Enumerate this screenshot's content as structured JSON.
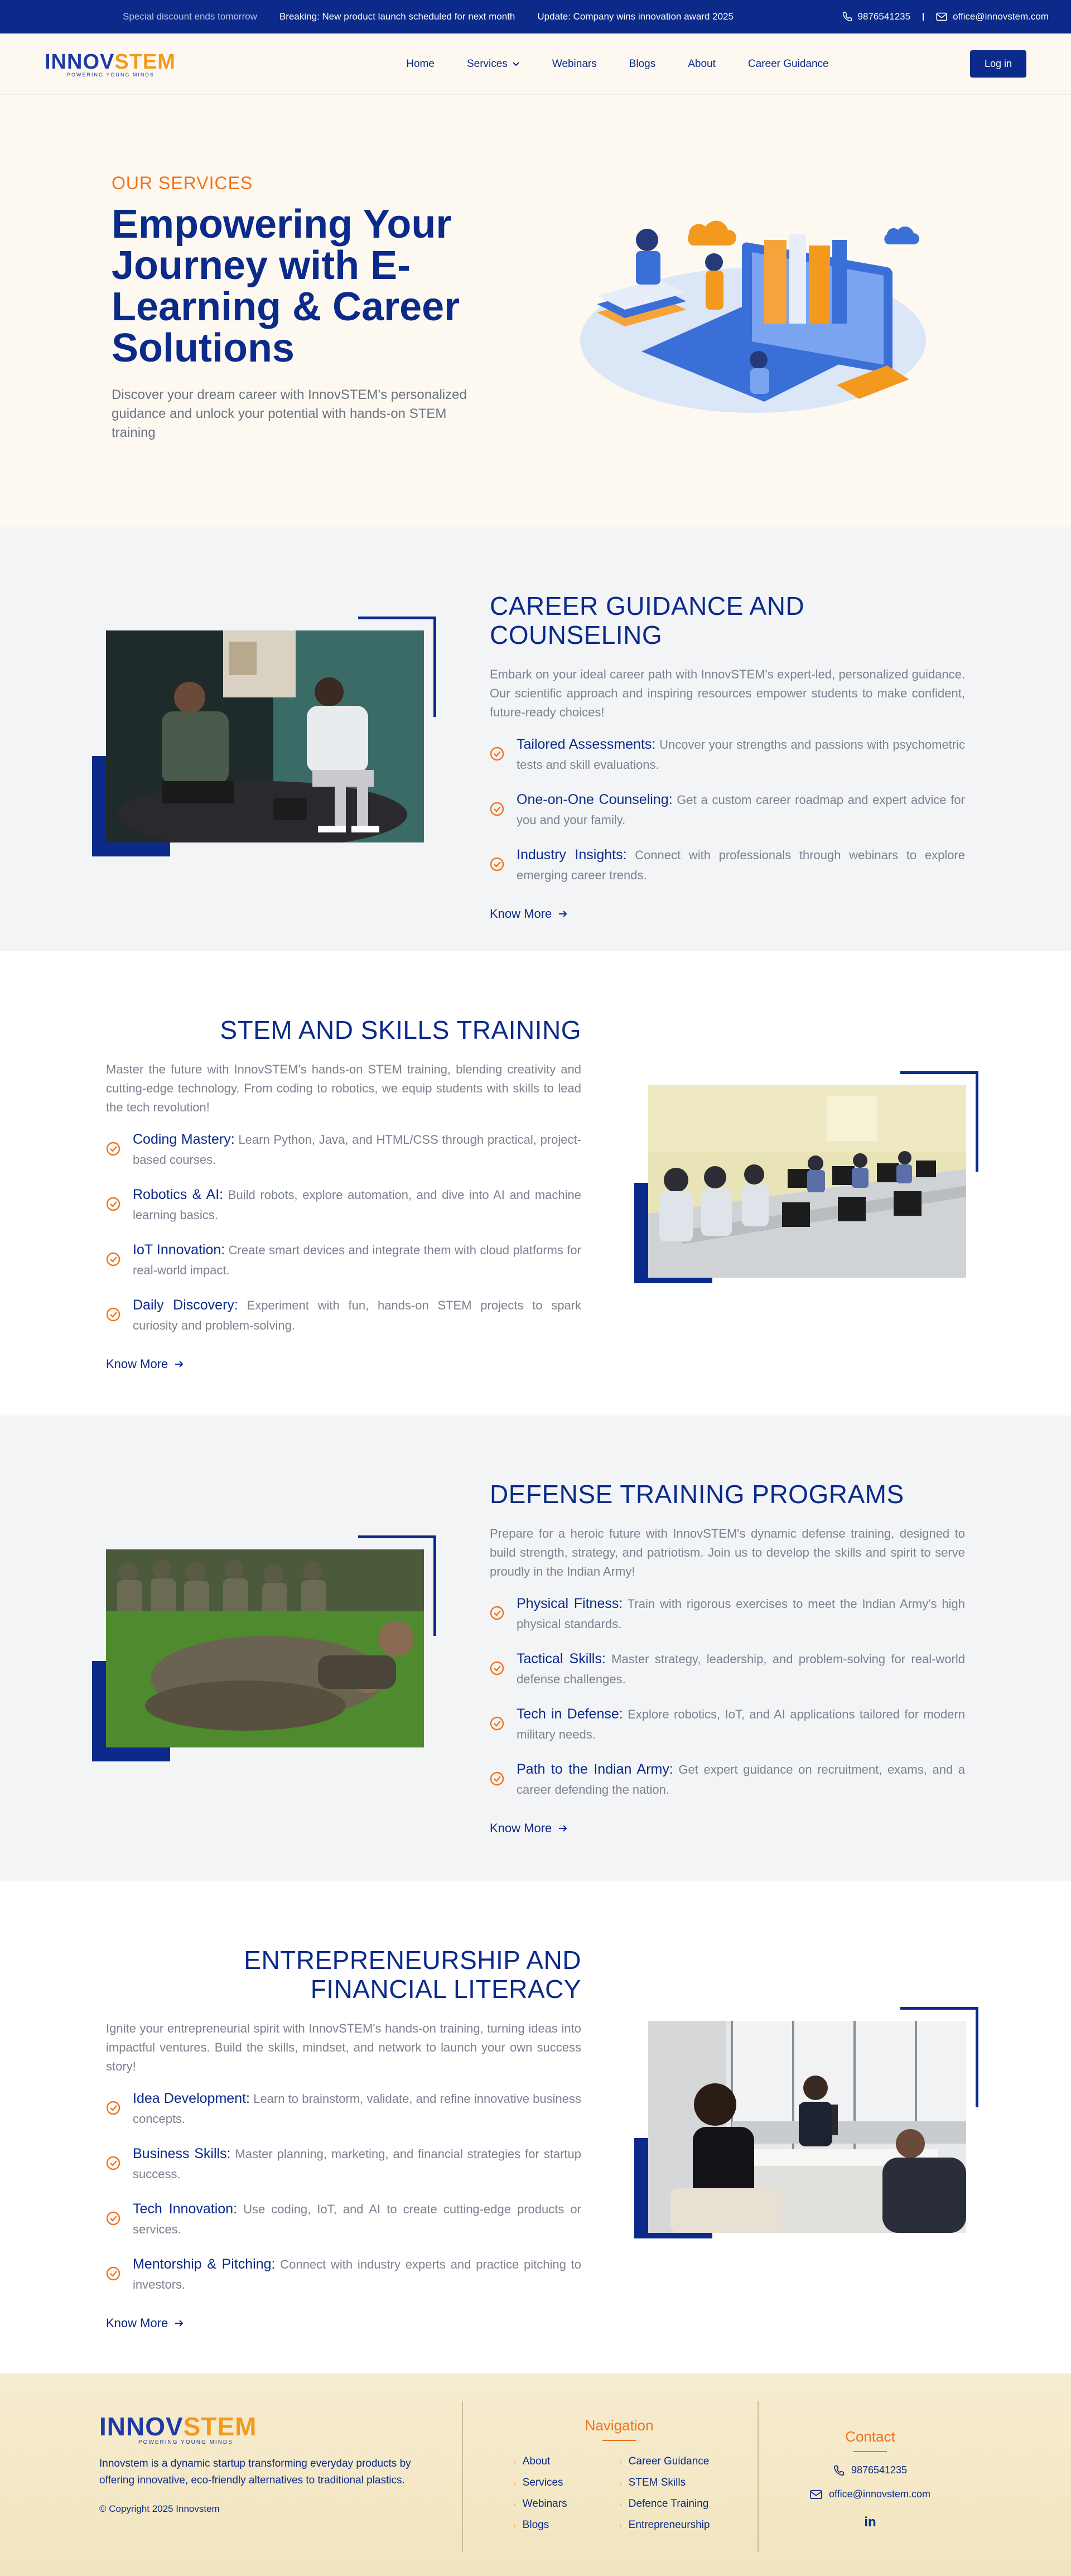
{
  "topbar": {
    "ticker": [
      "Special discount ends tomorrow",
      "Breaking: New product launch scheduled for next month",
      "Update: Company wins innovation award 2025"
    ],
    "phone": "9876541235",
    "email": "office@innovstem.com"
  },
  "nav": {
    "logo_part1": "INNOV",
    "logo_part2": "STEM",
    "logo_tagline": "POWERING YOUNG MINDS",
    "items": [
      "Home",
      "Services",
      "Webinars",
      "Blogs",
      "About",
      "Career Guidance"
    ],
    "login": "Log in"
  },
  "hero": {
    "eyebrow": "OUR SERVICES",
    "title": "Empowering Your Journey with E-Learning & Career Solutions",
    "description": "Discover your dream career with InnovSTEM's personalized guidance and unlock your potential with hands-on STEM training"
  },
  "sections": [
    {
      "title": "CAREER GUIDANCE AND COUNSELING",
      "intro": "Embark on your ideal career path with InnovSTEM's expert-led, personalized guidance. Our scientific approach and inspiring resources empower students to make confident, future-ready choices!",
      "points": [
        {
          "label": "Tailored Assessments:",
          "text": "Uncover your strengths and passions with psychometric tests and skill evaluations."
        },
        {
          "label": "One-on-One Counseling:",
          "text": "Get a custom career roadmap and expert advice for you and your family."
        },
        {
          "label": "Industry Insights:",
          "text": "Connect with professionals through webinars to explore emerging career trends."
        }
      ],
      "cta": "Know More"
    },
    {
      "title": "STEM AND SKILLS TRAINING",
      "intro": "Master the future with InnovSTEM's hands-on STEM training, blending creativity and cutting-edge technology. From coding to robotics, we equip students with skills to lead the tech revolution!",
      "points": [
        {
          "label": "Coding Mastery:",
          "text": "Learn Python, Java, and HTML/CSS through practical, project-based courses."
        },
        {
          "label": "Robotics & AI:",
          "text": "Build robots, explore automation, and dive into AI and machine learning basics."
        },
        {
          "label": "IoT Innovation:",
          "text": "Create smart devices and integrate them with cloud platforms for real-world impact."
        },
        {
          "label": "Daily Discovery:",
          "text": "Experiment with fun, hands-on STEM projects to spark curiosity and problem-solving."
        }
      ],
      "cta": "Know More"
    },
    {
      "title": "DEFENSE TRAINING PROGRAMS",
      "intro": "Prepare for a heroic future with InnovSTEM's dynamic defense training, designed to build strength, strategy, and patriotism. Join us to develop the skills and spirit to serve proudly in the Indian Army!",
      "points": [
        {
          "label": "Physical Fitness:",
          "text": "Train with rigorous exercises to meet the Indian Army's high physical standards."
        },
        {
          "label": "Tactical Skills:",
          "text": "Master strategy, leadership, and problem-solving for real-world defense challenges."
        },
        {
          "label": "Tech in Defense:",
          "text": "Explore robotics, IoT, and AI applications tailored for modern military needs."
        },
        {
          "label": "Path to the Indian Army:",
          "text": "Get expert guidance on recruitment, exams, and a career defending the nation."
        }
      ],
      "cta": "Know More"
    },
    {
      "title": "ENTREPRENEURSHIP AND FINANCIAL LITERACY",
      "intro": "Ignite your entrepreneurial spirit with InnovSTEM's hands-on training, turning ideas into impactful ventures. Build the skills, mindset, and network to launch your own success story!",
      "points": [
        {
          "label": "Idea Development:",
          "text": "Learn to brainstorm, validate, and refine innovative business concepts."
        },
        {
          "label": "Business Skills:",
          "text": "Master planning, marketing, and financial strategies for startup success."
        },
        {
          "label": "Tech Innovation:",
          "text": "Use coding, IoT, and AI to create cutting-edge products or services."
        },
        {
          "label": "Mentorship & Pitching:",
          "text": "Connect with industry experts and practice pitching to investors."
        }
      ],
      "cta": "Know More"
    }
  ],
  "footer": {
    "description": "Innovstem is a dynamic startup transforming everyday products by offering innovative, eco-friendly alternatives to traditional plastics.",
    "copyright": "© Copyright 2025 Innovstem",
    "nav_title": "Navigation",
    "links": [
      "About",
      "Career Guidance",
      "Services",
      "STEM Skills",
      "Webinars",
      "Defence Training",
      "Blogs",
      "Entrepreneurship"
    ],
    "contact_title": "Contact",
    "phone": "9876541235",
    "email": "office@innovstem.com",
    "social": "in"
  },
  "colors": {
    "primary": "#0b2a8a",
    "accent": "#f0731b",
    "cream": "#fdf9f1",
    "section_gray": "#f3f4f6"
  }
}
